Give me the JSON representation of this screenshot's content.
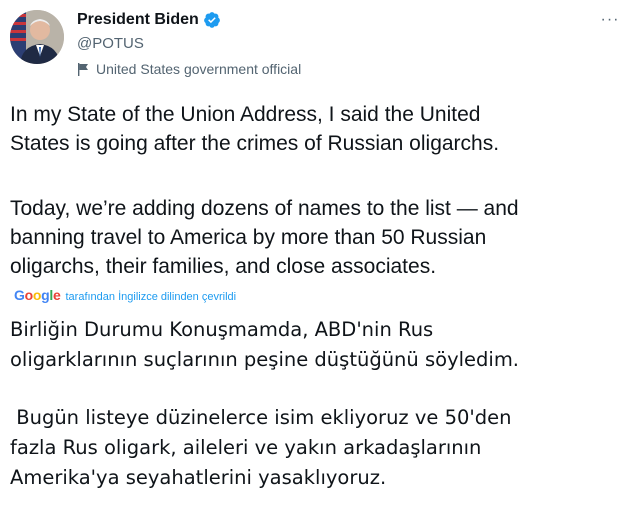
{
  "user": {
    "display_name": "President Biden",
    "handle": "@POTUS",
    "label": "United States government official"
  },
  "tweet": {
    "para1": "In my State of the Union Address, I said the United\nStates is going after the crimes of Russian oligarchs.",
    "para2": "Today, we’re adding dozens of names to the list — and\nbanning travel to America by more than 50 Russian\noligarchs, their families, and close associates."
  },
  "translation": {
    "provider": "Google",
    "note": "tarafından İngilizce dilinden çevrildi",
    "para1": "Birliğin Durumu Konuşmamda, ABD'nin Rus\noligarklarının suçlarının peşine düştüğünü söyledim.",
    "para2": " Bugün listeye düzinelerce isim ekliyoruz ve 50'den\nfazla Rus oligark, aileleri ve yakın arkadaşlarının\nAmerika'ya seyahatlerini yasaklıyoruz."
  },
  "colors": {
    "verified": "#1d9bf0",
    "secondary_text": "#536471",
    "link": "#1d9bf0"
  }
}
